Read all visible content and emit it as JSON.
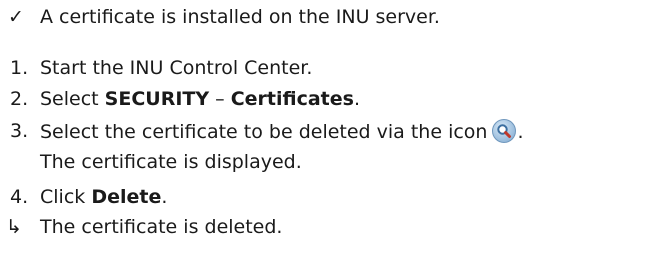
{
  "prerequisite": {
    "marker": "✓",
    "text": "A certificate is installed on the INU server."
  },
  "steps": [
    {
      "number": "1.",
      "text": "Start the INU Control Center."
    },
    {
      "number": "2.",
      "prefix": "Select ",
      "bold1": "SECURITY",
      "separator": " – ",
      "bold2": "Certificates",
      "suffix": "."
    },
    {
      "number": "3.",
      "text": "Select the certificate to be deleted via the icon",
      "suffix": ".",
      "icon": "search-icon",
      "result_text": "The certificate is displayed."
    },
    {
      "number": "4.",
      "prefix": "Click ",
      "bold": "Delete",
      "suffix": "."
    }
  ],
  "result": {
    "marker": "↳",
    "text": "The certificate is deleted."
  }
}
